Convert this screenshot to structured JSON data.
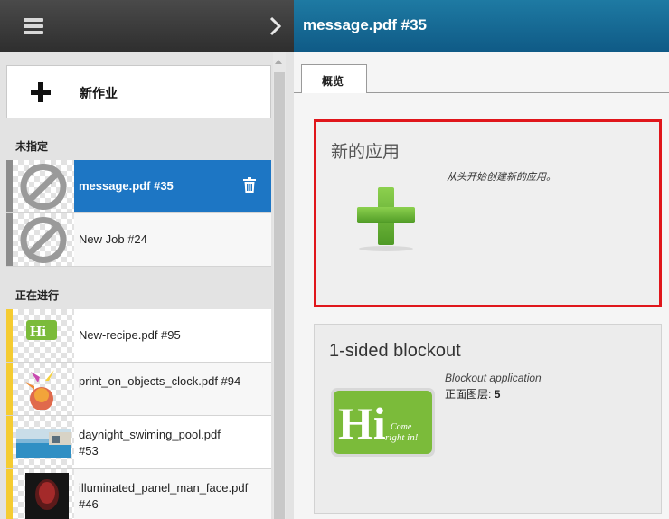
{
  "sidebar": {
    "new_job_label": "新作业",
    "sections": {
      "unassigned": "未指定",
      "in_progress": "正在进行"
    },
    "unassigned_jobs": [
      {
        "name": "message.pdf #35",
        "selected": true
      },
      {
        "name": "New Job #24",
        "selected": false
      }
    ],
    "in_progress_jobs": [
      {
        "name": "New-recipe.pdf #95"
      },
      {
        "name": "print_on_objects_clock.pdf #94"
      },
      {
        "name": "daynight_swiming_pool.pdf #53"
      },
      {
        "name": "illuminated_panel_man_face.pdf #46"
      }
    ],
    "icons": [
      "menu-icon",
      "chevron-right-icon",
      "plus-icon",
      "trash-icon",
      "no-image-icon"
    ]
  },
  "main": {
    "title": "message.pdf #35",
    "tabs": [
      {
        "label": "概览",
        "active": true
      }
    ],
    "new_application": {
      "title": "新的应用",
      "description": "从头开始创建新的应用。"
    },
    "recipe_card": {
      "title": "1-sided blockout",
      "subtitle": "Blockout application",
      "layers_label": "正面图层:",
      "layers_value": "5",
      "logo_text": "Hi",
      "logo_tagline_1": "Come",
      "logo_tagline_2": "right in!"
    }
  },
  "colors": {
    "selected_blue": "#1d76c4",
    "header_blue": "#135f8a",
    "highlight_red": "#e0161b",
    "status_gray": "#8c8c8c",
    "status_yellow": "#f5cc32",
    "plus_green": "#6db33f"
  }
}
